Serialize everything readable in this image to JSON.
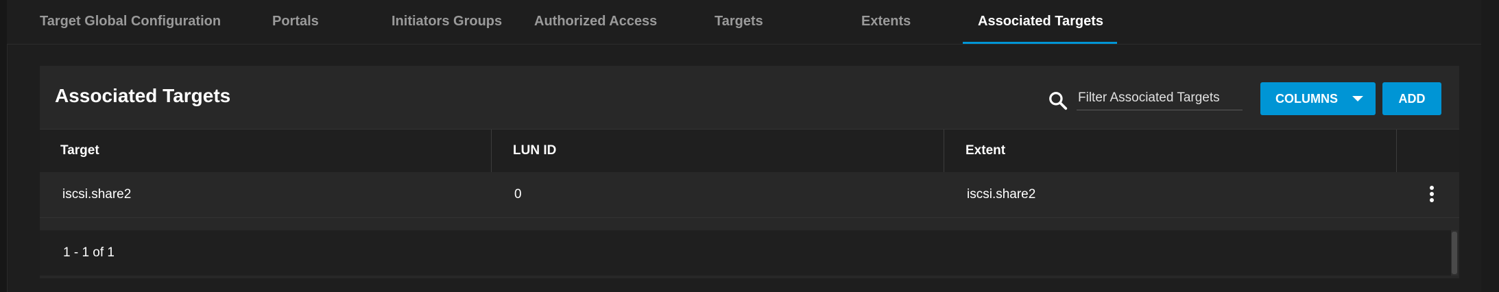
{
  "tabs": [
    {
      "label": "Target Global Configuration",
      "active": false
    },
    {
      "label": "Portals",
      "active": false
    },
    {
      "label": "Initiators Groups",
      "active": false
    },
    {
      "label": "Authorized Access",
      "active": false
    },
    {
      "label": "Targets",
      "active": false
    },
    {
      "label": "Extents",
      "active": false
    },
    {
      "label": "Associated Targets",
      "active": true
    }
  ],
  "card": {
    "title": "Associated Targets",
    "search_placeholder": "Filter Associated Targets",
    "columns_button": "COLUMNS",
    "add_button": "ADD"
  },
  "table": {
    "headers": [
      "Target",
      "LUN ID",
      "Extent"
    ],
    "rows": [
      {
        "target": "iscsi.share2",
        "lun_id": "0",
        "extent": "iscsi.share2"
      }
    ]
  },
  "pagination": {
    "range": "1 - 1 of 1"
  },
  "icons": {
    "search": "search-icon",
    "columns_caret": "caret-down-icon",
    "row_actions": "more-vert-icon"
  },
  "colors": {
    "accent": "#0095d5",
    "background": "#1e1e1e",
    "card": "#282828"
  }
}
